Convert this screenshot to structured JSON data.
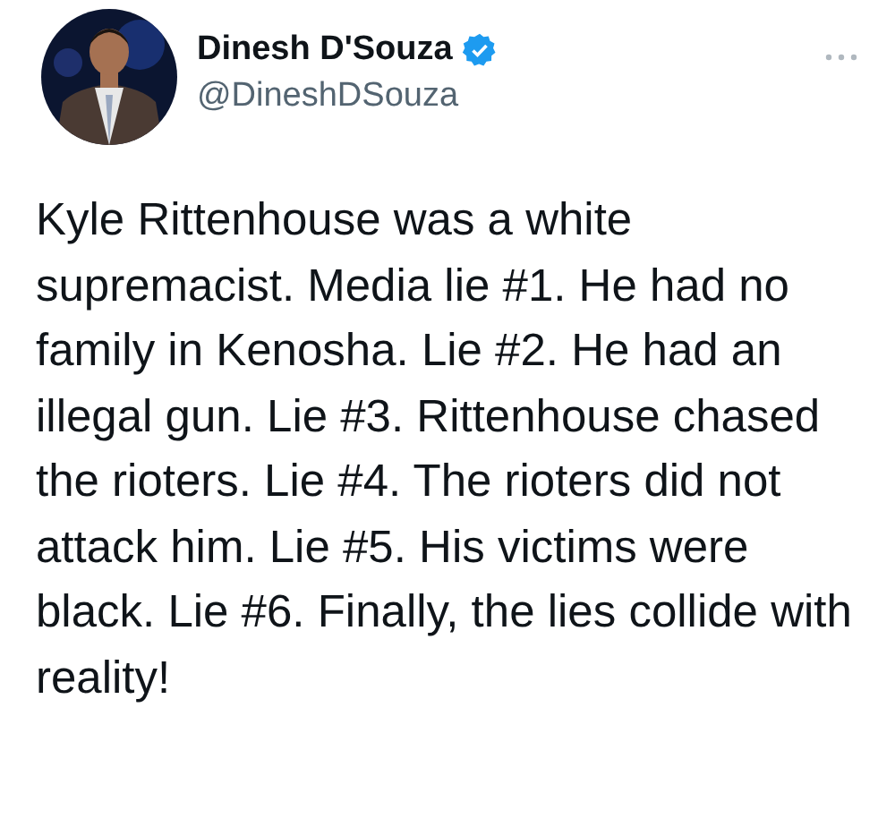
{
  "author": {
    "name": "Dinesh D'Souza",
    "verified": true,
    "handle": "@DineshDSouza"
  },
  "tweet": {
    "text": "Kyle Rittenhouse was a white supremacist. Media lie #1. He had no family in Kenosha. Lie #2. He had an illegal gun. Lie #3. Rittenhouse chased the rioters. Lie #4. The rioters did not attack him. Lie #5. His victims were black. Lie #6. Finally, the lies collide with reality!"
  }
}
